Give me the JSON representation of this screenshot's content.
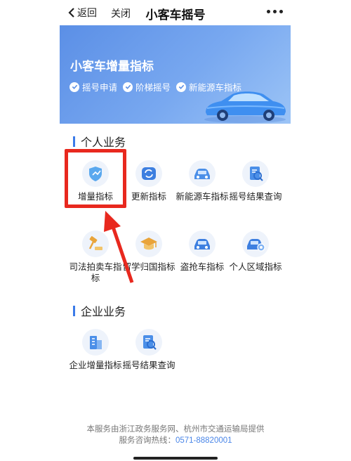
{
  "header": {
    "back_label": "返回",
    "close_label": "关闭",
    "title": "小客车摇号"
  },
  "banner": {
    "title": "小客车增量指标",
    "features": [
      "摇号申请",
      "阶梯摇号",
      "新能源车指标"
    ]
  },
  "sections": {
    "personal": {
      "title": "个人业务",
      "items": [
        {
          "label": "增量指标",
          "icon": "shield-icon"
        },
        {
          "label": "更新指标",
          "icon": "refresh-icon"
        },
        {
          "label": "新能源车指标",
          "icon": "car-icon"
        },
        {
          "label": "摇号结果查询",
          "icon": "search-doc-icon"
        },
        {
          "label": "司法拍卖车指标",
          "icon": "gavel-icon"
        },
        {
          "label": "留学归国指标",
          "icon": "graduation-cap-icon"
        },
        {
          "label": "盗抢车指标",
          "icon": "car-icon"
        },
        {
          "label": "个人区域指标",
          "icon": "car-region-icon"
        }
      ]
    },
    "enterprise": {
      "title": "企业业务",
      "items": [
        {
          "label": "企业增量指标",
          "icon": "building-icon"
        },
        {
          "label": "摇号结果查询",
          "icon": "search-doc-icon"
        }
      ]
    }
  },
  "footer": {
    "provider": "本服务由浙江政务服务网、杭州市交通运输局提供",
    "hotline_label": "服务咨询热线：",
    "hotline_number": "0571-88820001"
  },
  "colors": {
    "accent": "#3b7be8",
    "highlight": "#e8281e",
    "banner": "#6b9ceb"
  }
}
